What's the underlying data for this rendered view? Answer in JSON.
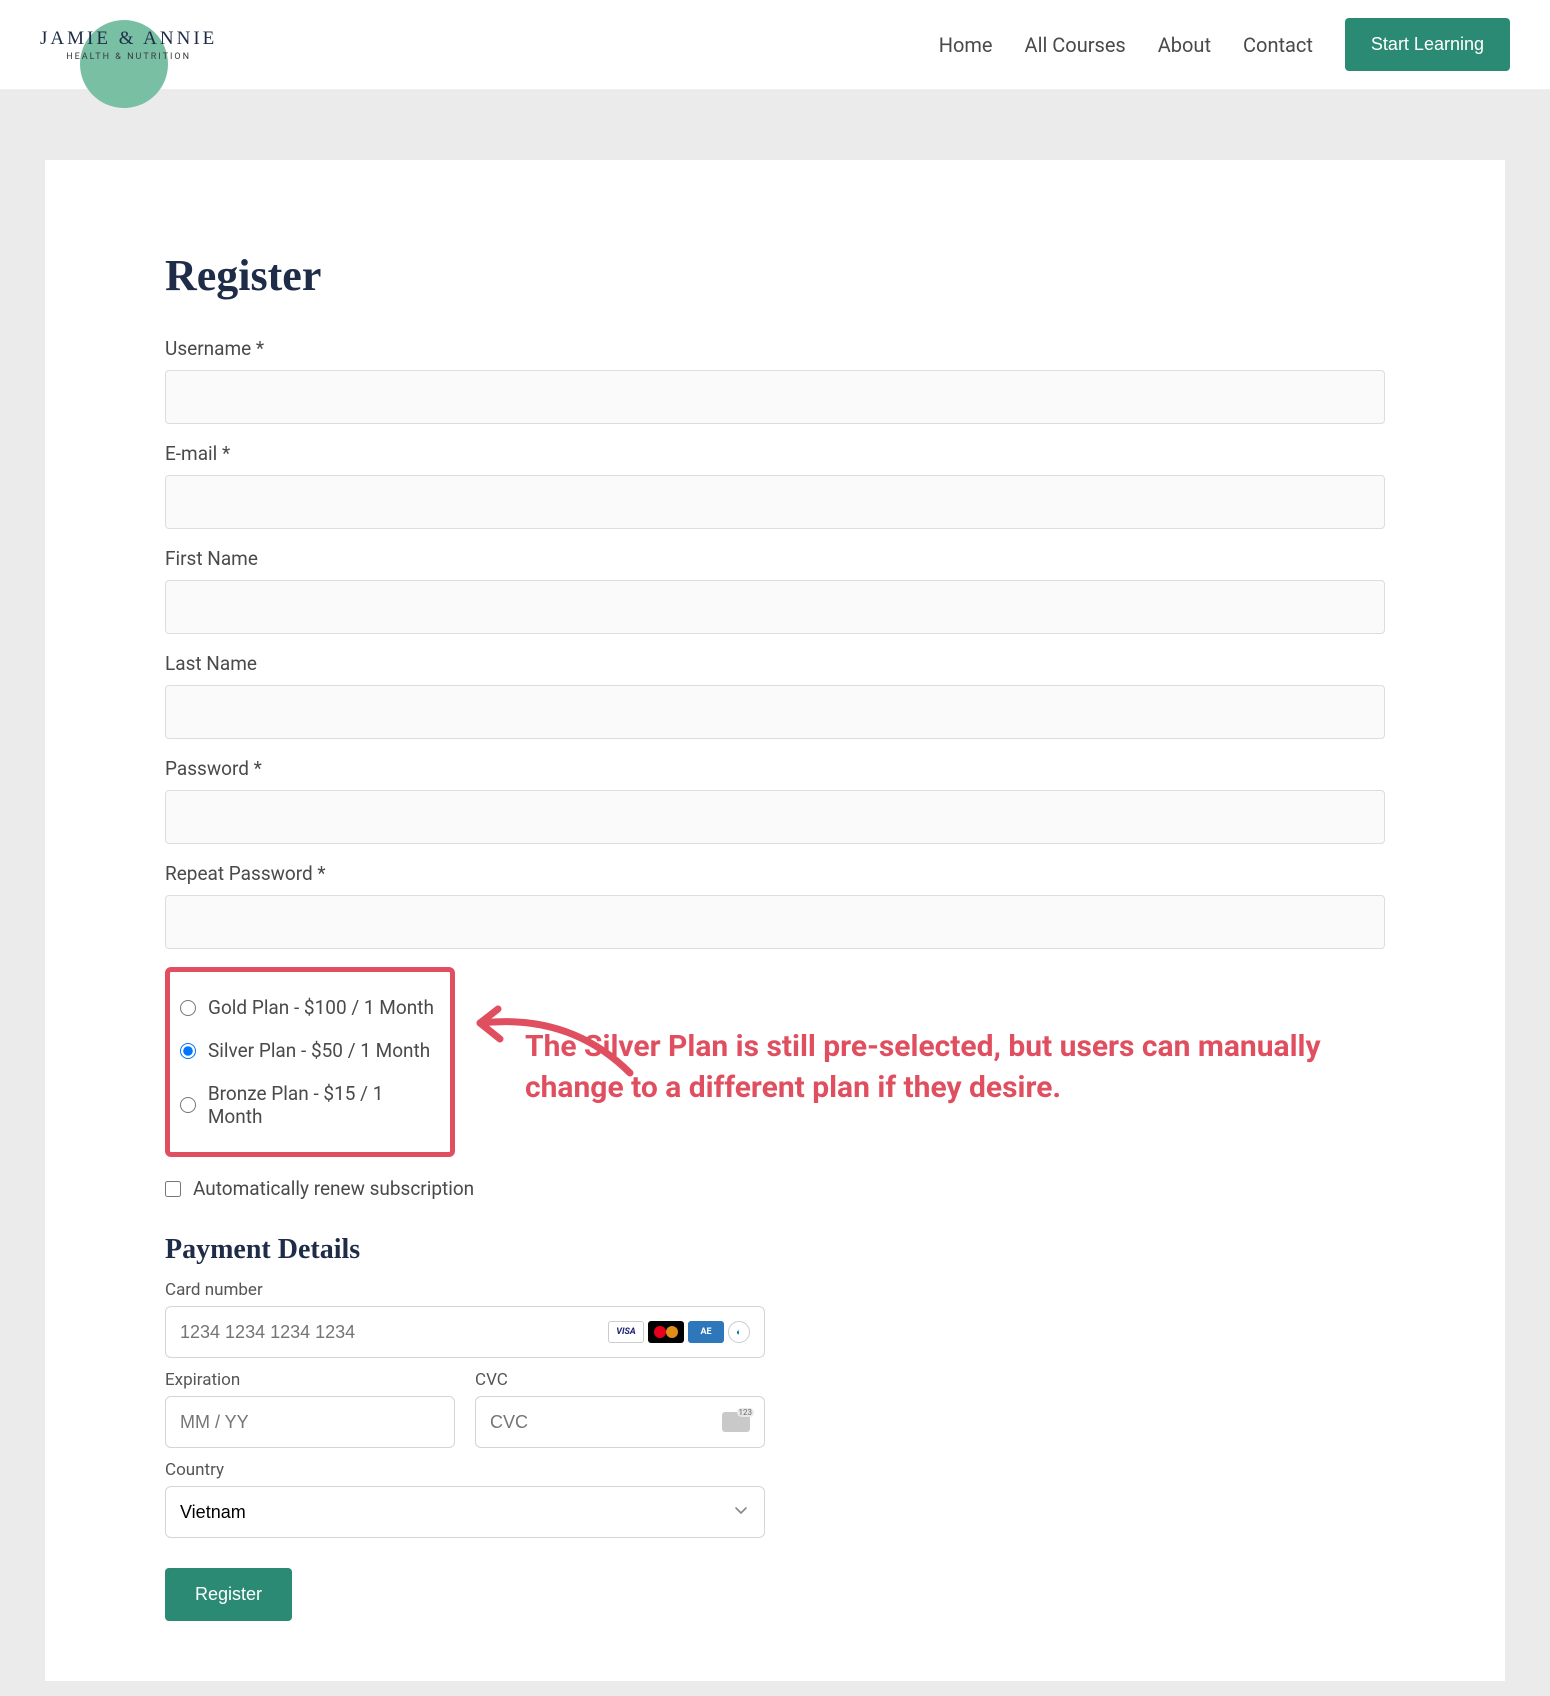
{
  "logo": {
    "title": "JAMIE & ANNIE",
    "subtitle": "HEALTH & NUTRITION"
  },
  "nav": {
    "home": "Home",
    "courses": "All Courses",
    "about": "About",
    "contact": "Contact",
    "cta": "Start Learning"
  },
  "page": {
    "title": "Register"
  },
  "fields": {
    "username": "Username *",
    "email": "E-mail *",
    "first_name": "First Name",
    "last_name": "Last Name",
    "password": "Password *",
    "repeat_password": "Repeat Password *"
  },
  "plans": {
    "gold": "Gold Plan - $100 / 1 Month",
    "silver": "Silver Plan - $50 / 1 Month",
    "bronze": "Bronze Plan - $15 / 1 Month"
  },
  "auto_renew": "Automatically renew subscription",
  "payment": {
    "title": "Payment Details",
    "card_label": "Card number",
    "card_placeholder": "1234 1234 1234 1234",
    "exp_label": "Expiration",
    "exp_placeholder": "MM / YY",
    "cvc_label": "CVC",
    "cvc_placeholder": "CVC",
    "country_label": "Country",
    "country_value": "Vietnam"
  },
  "submit": "Register",
  "annotation": "The Silver Plan is still pre-selected, but users can manually change to a different plan if they desire."
}
